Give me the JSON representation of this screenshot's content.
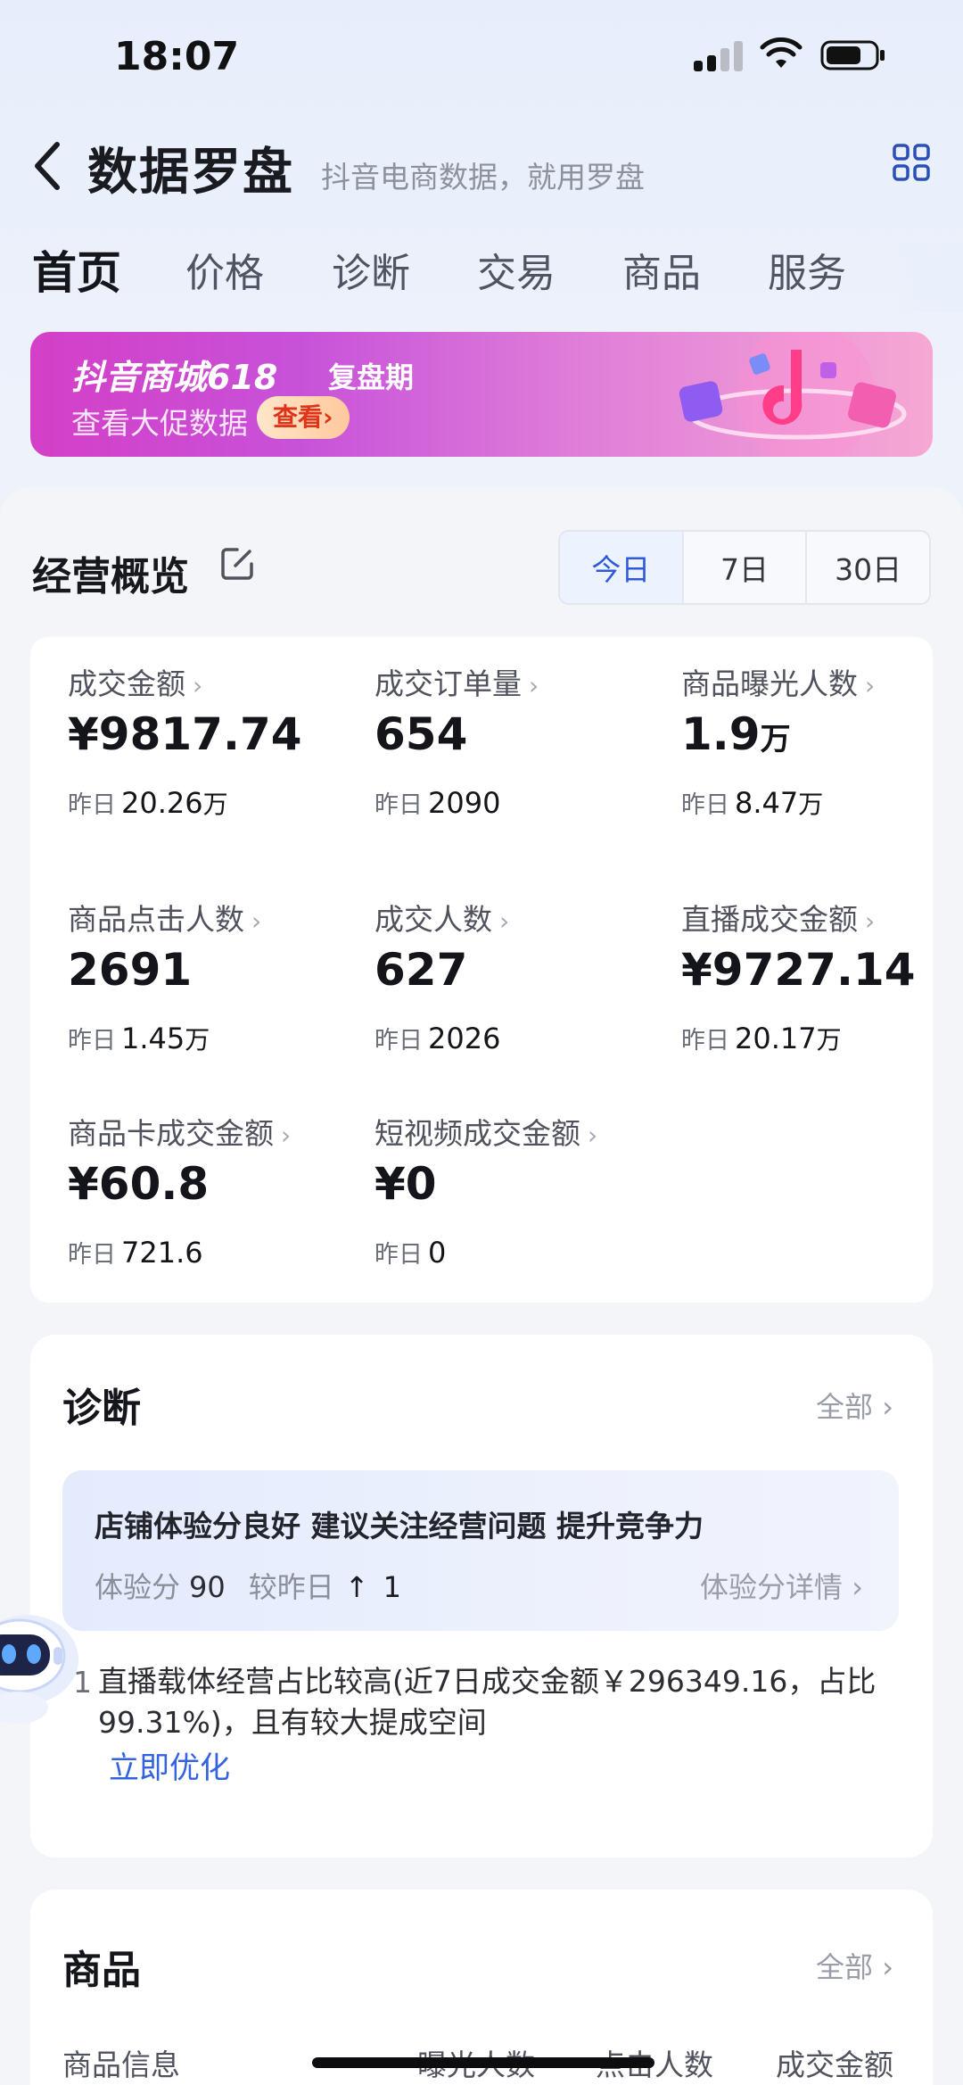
{
  "status_bar": {
    "time": "18:07"
  },
  "header": {
    "title": "数据罗盘",
    "subtitle": "抖音电商数据，就用罗盘"
  },
  "tabs": [
    "首页",
    "价格",
    "诊断",
    "交易",
    "商品",
    "服务"
  ],
  "banner": {
    "title": "抖音商城618",
    "tag": "复盘期",
    "subtitle": "查看大促数据",
    "button": "查看›"
  },
  "overview": {
    "title": "经营概览",
    "ranges": [
      "今日",
      "7日",
      "30日"
    ],
    "active_range": "今日",
    "prev_label": "昨日",
    "metrics": [
      {
        "label": "成交金额",
        "value": "¥9817.74",
        "value_unit": "",
        "prev": "20.26",
        "prev_unit": "万"
      },
      {
        "label": "成交订单量",
        "value": "654",
        "value_unit": "",
        "prev": "2090",
        "prev_unit": ""
      },
      {
        "label": "商品曝光人数",
        "value": "1.9",
        "value_unit": "万",
        "prev": "8.47",
        "prev_unit": "万"
      },
      {
        "label": "商品点击人数",
        "value": "2691",
        "value_unit": "",
        "prev": "1.45",
        "prev_unit": "万"
      },
      {
        "label": "成交人数",
        "value": "627",
        "value_unit": "",
        "prev": "2026",
        "prev_unit": ""
      },
      {
        "label": "直播成交金额",
        "value": "¥9727.14",
        "value_unit": "",
        "prev": "20.17",
        "prev_unit": "万"
      },
      {
        "label": "商品卡成交金额",
        "value": "¥60.8",
        "value_unit": "",
        "prev": "721.6",
        "prev_unit": ""
      },
      {
        "label": "短视频成交金额",
        "value": "¥0",
        "value_unit": "",
        "prev": "0",
        "prev_unit": ""
      }
    ]
  },
  "diagnosis": {
    "title": "诊断",
    "all_label": "全部 ›",
    "summary_title": "店铺体验分良好 建议关注经营问题 提升竞争力",
    "score_label": "体验分",
    "score_value": "90",
    "compare_label": "较昨日",
    "compare_arrow": "↑",
    "compare_value": "1",
    "detail_link": "体验分详情 ›",
    "issue_index": "1",
    "issue_text": "直播载体经营占比较高(近7日成交金额￥296349.16，占比99.31%)，且有较大提成空间",
    "issue_action": "立即优化"
  },
  "products": {
    "title": "商品",
    "all_label": "全部 ›",
    "columns": [
      "商品信息",
      "曝光人数",
      "点击人数",
      "成交金额"
    ]
  },
  "colors": {
    "accent": "#2f5ad8",
    "link": "#3463e0",
    "banner_start": "#d43fc7",
    "banner_end": "#f6a8d4"
  }
}
